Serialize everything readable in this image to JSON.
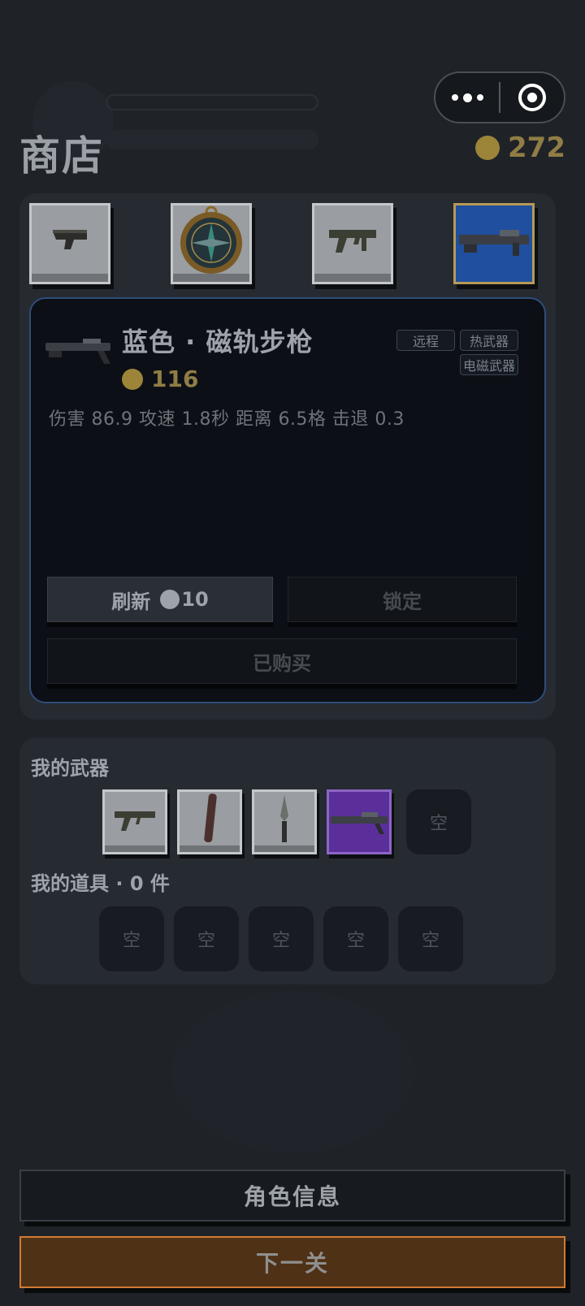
{
  "header": {
    "title": "商店",
    "coins": "272"
  },
  "shop": {
    "offers": [
      {
        "name": "pistol",
        "selected": false
      },
      {
        "name": "compass",
        "selected": false
      },
      {
        "name": "smg",
        "selected": false
      },
      {
        "name": "railgun",
        "selected": true
      }
    ],
    "detail": {
      "name": "蓝色 · 磁轨步枪",
      "price": "116",
      "tags": [
        "远程",
        "热武器",
        "电磁武器"
      ],
      "stats": "伤害 86.9  攻速 1.8秒  距离 6.5格  击退 0.3"
    },
    "refresh_label": "刷新",
    "refresh_cost": "10",
    "lock_label": "锁定",
    "bought_label": "已购买"
  },
  "inventory": {
    "weapons_label": "我的武器",
    "weapons": [
      "smg",
      "bat",
      "knife",
      "railgun"
    ],
    "empty_label": "空",
    "items_label": "我的道具 · 0 件"
  },
  "footer": {
    "role_label": "角色信息",
    "next_label": "下一关"
  },
  "colors": {
    "background": "#1f2328",
    "coin": "#9c8439",
    "selected_slot": "#1f4f9e",
    "purple_slot": "#5a2f9a",
    "next_button": "#4f3115"
  }
}
